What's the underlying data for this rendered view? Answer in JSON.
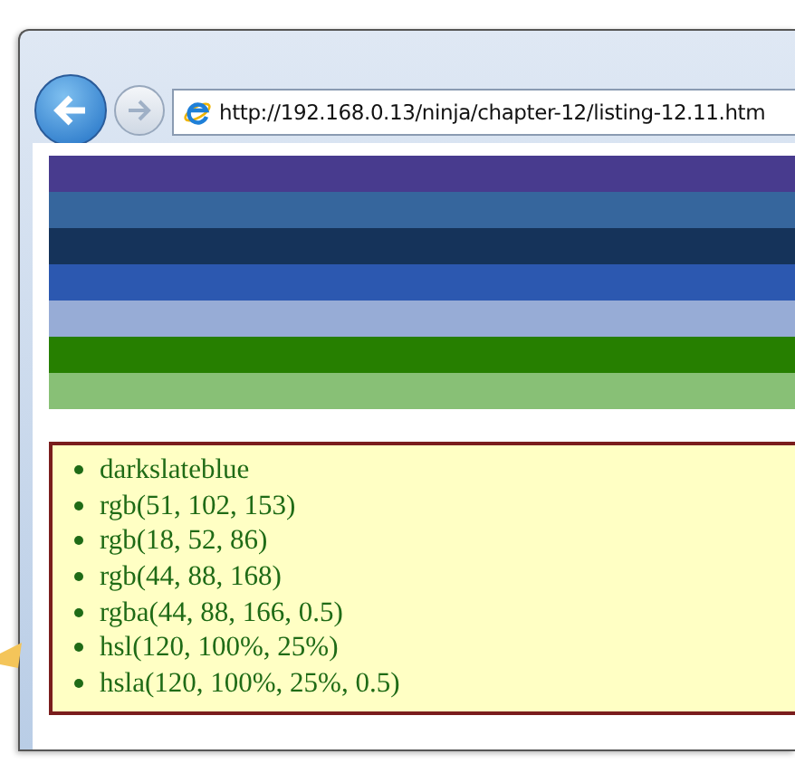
{
  "address_bar": {
    "url": "http://192.168.0.13/ninja/chapter-12/listing-12.11.htm"
  },
  "stripes": [
    {
      "color": "#483b8e"
    },
    {
      "color": "#36669d"
    },
    {
      "color": "#15335a"
    },
    {
      "color": "#2c58b0"
    },
    {
      "color": "#97acd6"
    },
    {
      "color": "#267f00"
    },
    {
      "color": "#88c076"
    }
  ],
  "color_list": [
    "darkslateblue",
    "rgb(51, 102, 153)",
    "rgb(18, 52, 86)",
    "rgb(44, 88, 168)",
    "rgba(44, 88, 166, 0.5)",
    "hsl(120, 100%, 25%)",
    "hsla(120, 100%, 25%, 0.5)"
  ]
}
